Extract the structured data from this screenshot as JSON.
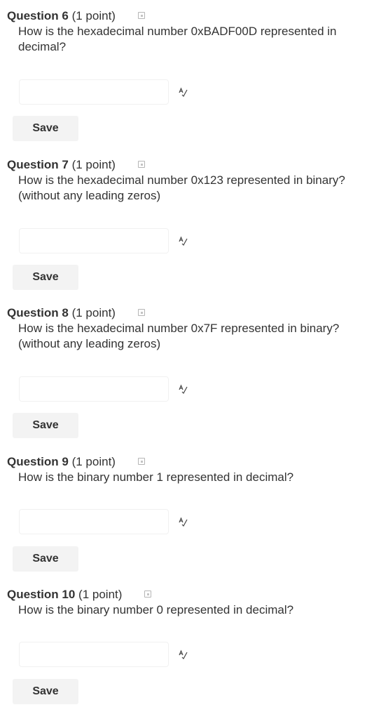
{
  "questions": [
    {
      "number": "Question 6",
      "points": "(1 point)",
      "text": "How is the hexadecimal number 0xBADF00D represented in decimal?",
      "answer_value": "",
      "save_label": "Save"
    },
    {
      "number": "Question 7",
      "points": "(1 point)",
      "text": "How is the hexadecimal number 0x123 represented in binary?  (without any leading zeros)",
      "answer_value": "",
      "save_label": "Save"
    },
    {
      "number": "Question 8",
      "points": "(1 point)",
      "text": "How is the hexadecimal number 0x7F represented in binary?  (without any leading zeros)",
      "answer_value": "",
      "save_label": "Save"
    },
    {
      "number": "Question 9",
      "points": "(1 point)",
      "text": "How is the binary number 1 represented in decimal?",
      "answer_value": "",
      "save_label": "Save"
    },
    {
      "number": "Question 10",
      "points": "(1 point)",
      "text": "How is the binary number 0 represented in decimal?",
      "answer_value": "",
      "save_label": "Save"
    }
  ],
  "icons": {
    "flag": "flag-question-icon",
    "spell": "spell-check-icon"
  }
}
